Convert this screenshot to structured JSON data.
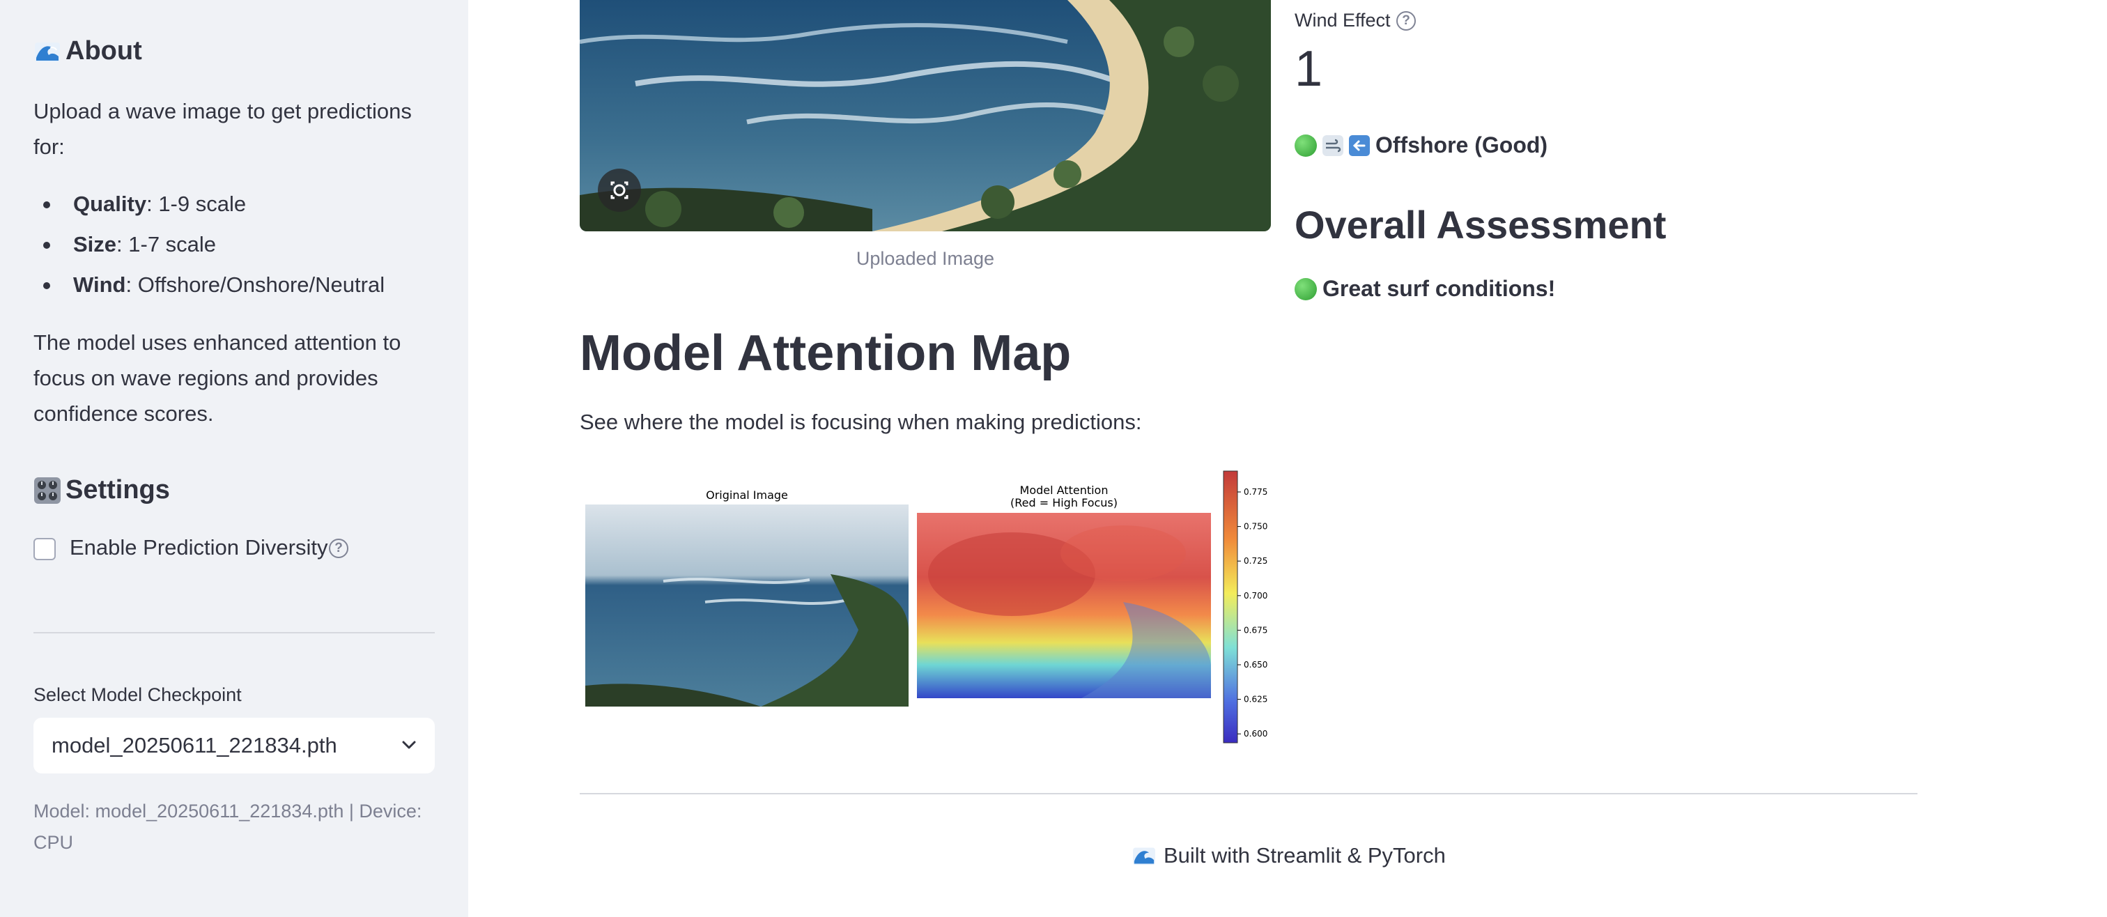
{
  "sidebar": {
    "about_title": "About",
    "about_intro": "Upload a wave image to get predictions for:",
    "features": [
      {
        "name": "Quality",
        "desc": ": 1-9 scale"
      },
      {
        "name": "Size",
        "desc": ": 1-7 scale"
      },
      {
        "name": "Wind",
        "desc": ": Offshore/Onshore/Neutral"
      }
    ],
    "about_body": "The model uses enhanced attention to focus on wave regions and provides confidence scores.",
    "settings_title": "Settings",
    "diversity_label": "Enable Prediction Diversity",
    "diversity_checked": false,
    "select_label": "Select Model Checkpoint",
    "select_value": "model_20250611_221834.pth",
    "model_info": "Model: model_20250611_221834.pth | Device: CPU"
  },
  "main": {
    "image_caption": "Uploaded Image",
    "attention_title": "Model Attention Map",
    "attention_desc": "See where the model is focusing when making predictions:",
    "attention_figure": {
      "left_title": "Original Image",
      "right_title_line1": "Model Attention",
      "right_title_line2": "(Red = High Focus)",
      "colorbar_ticks": [
        "0.775",
        "0.750",
        "0.725",
        "0.700",
        "0.675",
        "0.650",
        "0.625",
        "0.600"
      ]
    },
    "footer": "Built with Streamlit & PyTorch"
  },
  "results": {
    "metric_label": "Wind Effect",
    "metric_value": "1",
    "wind_status": "Offshore (Good)",
    "assessment_title": "Overall Assessment",
    "assessment_text": "Great surf conditions!"
  },
  "colors": {
    "sidebar_bg": "#f0f2f6",
    "text": "#31333f",
    "muted": "#7d8091",
    "status_green": "#2e9e32"
  }
}
